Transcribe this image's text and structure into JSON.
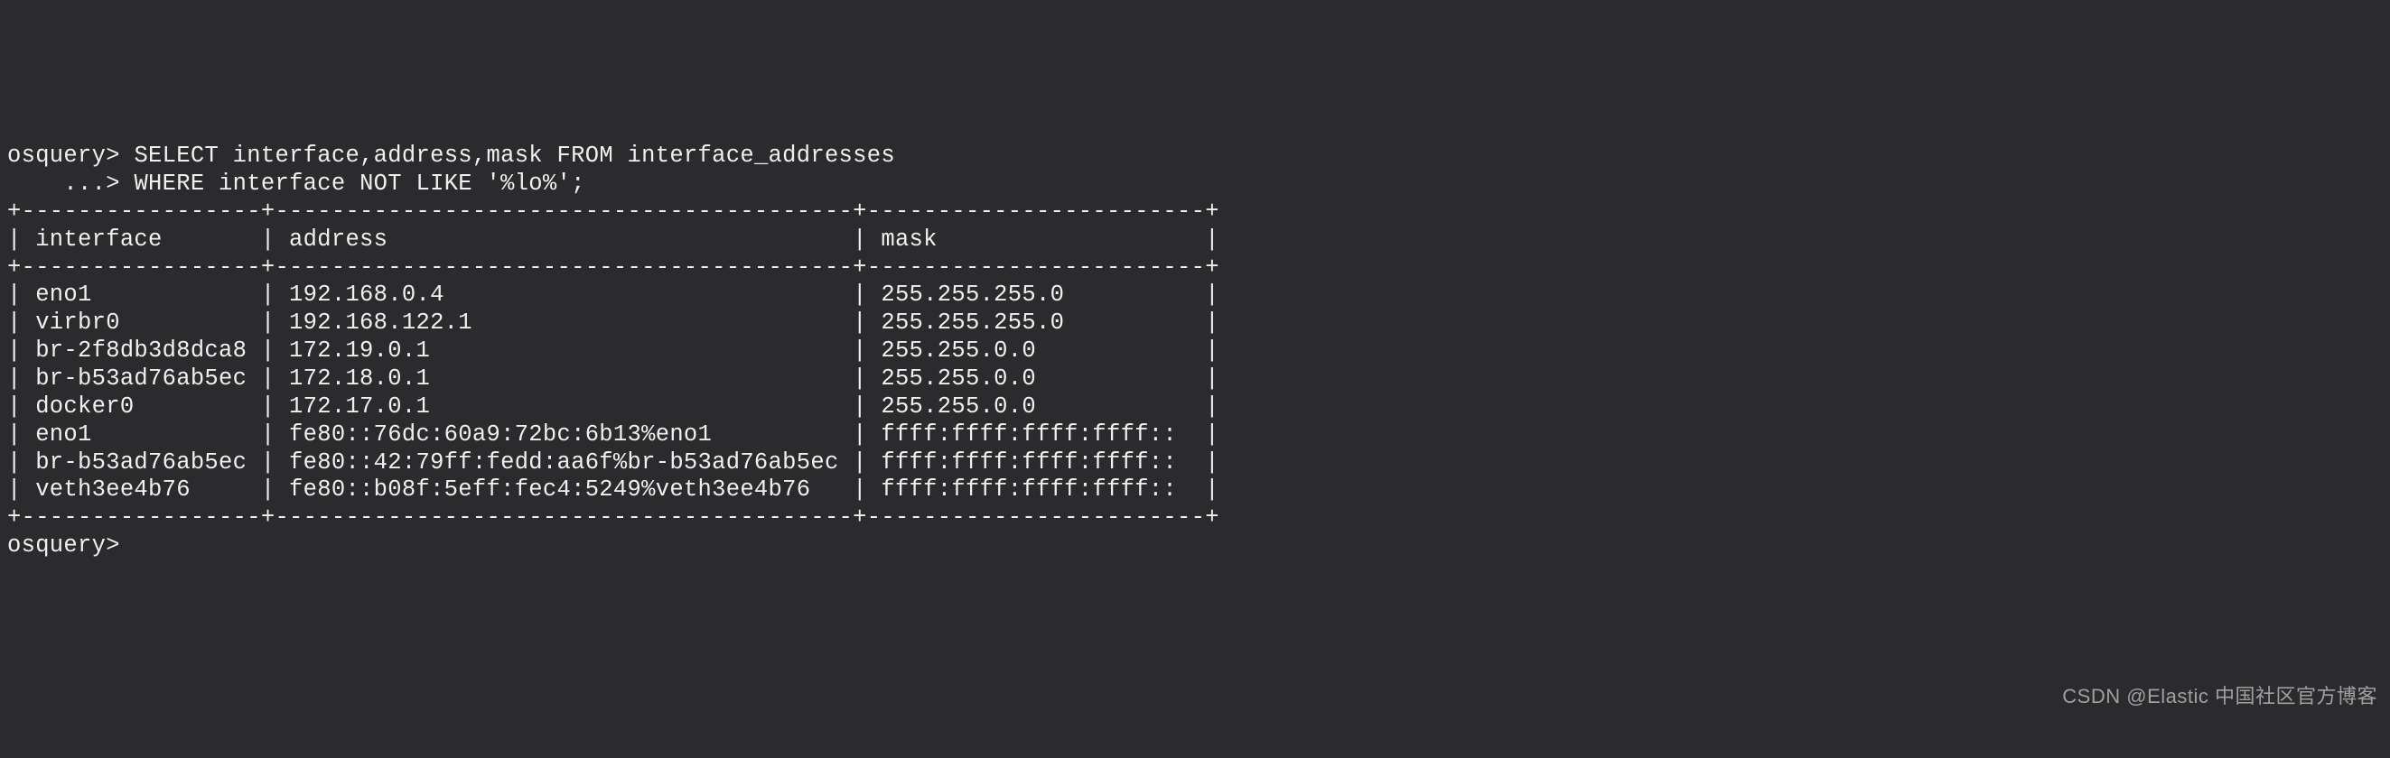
{
  "prompt1": "osquery> ",
  "query_line1": "SELECT interface,address,mask FROM interface_addresses",
  "prompt2": "    ...> ",
  "query_line2": "WHERE interface NOT LIKE '%lo%';",
  "table_border": "+-----------------+-----------------------------------------+------------------------+",
  "header": "| interface       | address                                 | mask                   |",
  "rows": [
    "| eno1            | 192.168.0.4                             | 255.255.255.0          |",
    "| virbr0          | 192.168.122.1                           | 255.255.255.0          |",
    "| br-2f8db3d8dca8 | 172.19.0.1                              | 255.255.0.0            |",
    "| br-b53ad76ab5ec | 172.18.0.1                              | 255.255.0.0            |",
    "| docker0         | 172.17.0.1                              | 255.255.0.0            |",
    "| eno1            | fe80::76dc:60a9:72bc:6b13%eno1          | ffff:ffff:ffff:ffff::  |",
    "| br-b53ad76ab5ec | fe80::42:79ff:fedd:aa6f%br-b53ad76ab5ec | ffff:ffff:ffff:ffff::  |",
    "| veth3ee4b76     | fe80::b08f:5eff:fec4:5249%veth3ee4b76   | ffff:ffff:ffff:ffff::  |"
  ],
  "prompt3": "osquery> ",
  "watermark": "CSDN @Elastic 中国社区官方博客"
}
